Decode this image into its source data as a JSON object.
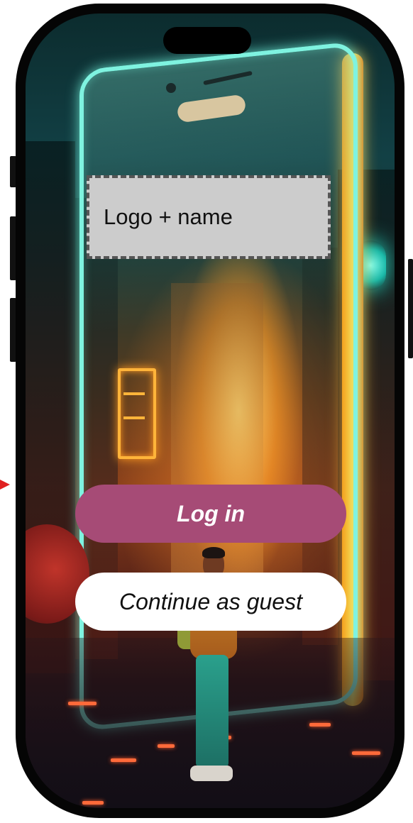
{
  "logo_placeholder": {
    "text": "Logo + name"
  },
  "actions": {
    "login_label": "Log in",
    "guest_label": "Continue as guest"
  },
  "colors": {
    "login_button": "#a64b76",
    "guest_button": "#ffffff",
    "logo_box": "#cccccc",
    "phone_frame": "#050505",
    "annotation_arrow": "#e02020"
  },
  "icons": [
    "annotation-arrow-icon"
  ]
}
